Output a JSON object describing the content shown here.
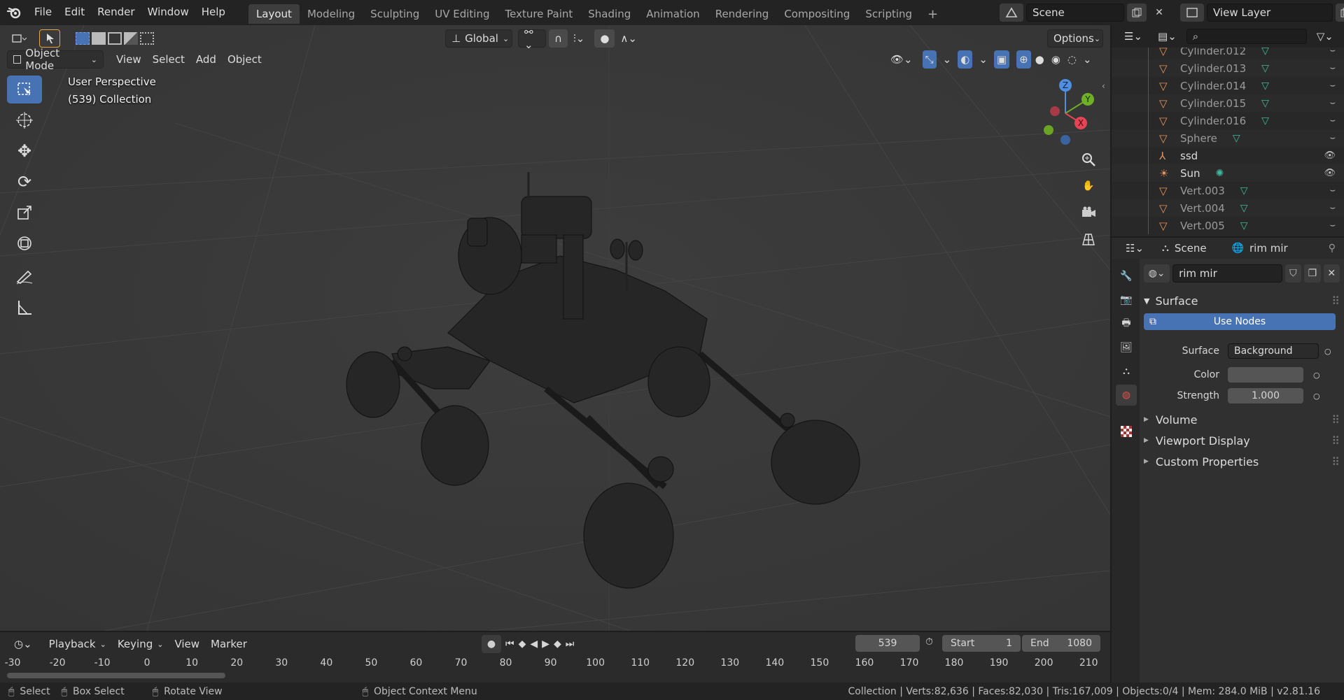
{
  "topbar": {
    "menus": [
      "File",
      "Edit",
      "Render",
      "Window",
      "Help"
    ],
    "workspaces": [
      "Layout",
      "Modeling",
      "Sculpting",
      "UV Editing",
      "Texture Paint",
      "Shading",
      "Animation",
      "Rendering",
      "Compositing",
      "Scripting"
    ],
    "active_workspace": "Layout",
    "scene_name": "Scene",
    "view_layer": "View Layer"
  },
  "viewport_header": {
    "transform_orientation": "Global",
    "options_label": "Options",
    "mode": "Object Mode",
    "menus": [
      "View",
      "Select",
      "Add",
      "Object"
    ]
  },
  "viewport_overlay": {
    "view_name": "User Perspective",
    "collection_info": "(539) Collection"
  },
  "gizmo_axes": {
    "x": "X",
    "y": "Y",
    "z": "Z"
  },
  "outliner": {
    "rows": [
      {
        "name": "Cylinder.012",
        "type": "mesh"
      },
      {
        "name": "Cylinder.013",
        "type": "mesh"
      },
      {
        "name": "Cylinder.014",
        "type": "mesh"
      },
      {
        "name": "Cylinder.015",
        "type": "mesh"
      },
      {
        "name": "Cylinder.016",
        "type": "mesh"
      },
      {
        "name": "Sphere",
        "type": "mesh"
      },
      {
        "name": "ssd",
        "type": "armature"
      },
      {
        "name": "Sun",
        "type": "light"
      },
      {
        "name": "Vert.003",
        "type": "mesh"
      },
      {
        "name": "Vert.004",
        "type": "mesh"
      },
      {
        "name": "Vert.005",
        "type": "mesh"
      }
    ]
  },
  "properties": {
    "breadcrumb_scene": "Scene",
    "breadcrumb_world": "rim mir",
    "world_name": "rim mir",
    "surface_section": "Surface",
    "use_nodes_label": "Use Nodes",
    "surface_label": "Surface",
    "surface_value": "Background",
    "color_label": "Color",
    "strength_label": "Strength",
    "strength_value": "1.000",
    "collapsed_sections": [
      "Volume",
      "Viewport Display",
      "Custom Properties"
    ]
  },
  "timeline": {
    "menus": [
      "Playback",
      "Keying",
      "View",
      "Marker"
    ],
    "current_frame": "539",
    "start_label": "Start",
    "start_value": "1",
    "end_label": "End",
    "end_value": "1080",
    "ruler_ticks": [
      "-30",
      "-20",
      "-10",
      "0",
      "10",
      "20",
      "30",
      "40",
      "50",
      "60",
      "70",
      "80",
      "90",
      "100",
      "110",
      "120",
      "130",
      "140",
      "150",
      "160",
      "170",
      "180",
      "190",
      "200",
      "210"
    ]
  },
  "statusbar": {
    "select": "Select",
    "box_select": "Box Select",
    "rotate_view": "Rotate View",
    "context_menu": "Object Context Menu",
    "stats": "Collection | Verts:82,636 | Faces:82,030 | Tris:167,009 | Objects:0/4 | Mem: 284.0 MiB | v2.81.16"
  },
  "colors": {
    "accent": "#4772b3",
    "viewport_bg": "#3a3a3a",
    "mesh_icon": "#e8945b",
    "data_icon": "#3fb99b"
  }
}
